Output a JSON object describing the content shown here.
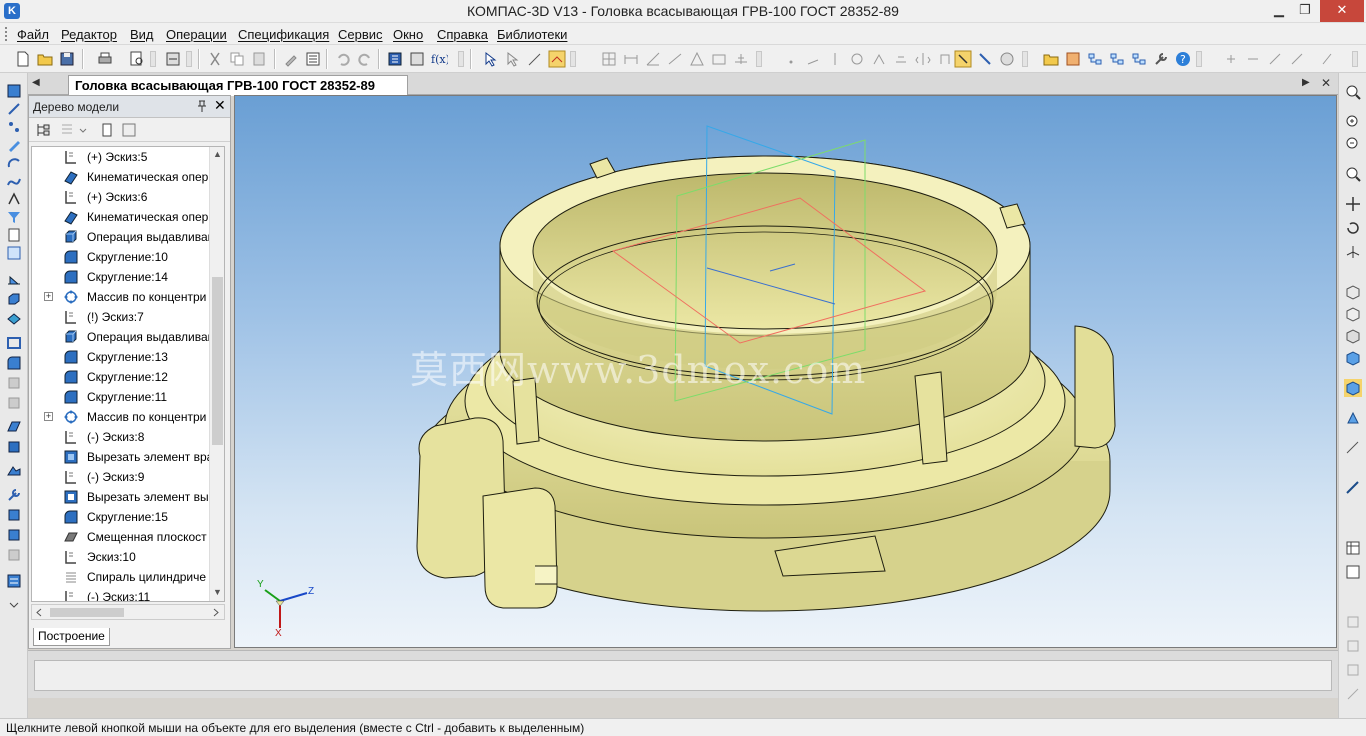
{
  "window": {
    "title": "КОМПАС-3D V13 - Головка всасывающая ГРВ-100 ГОСТ 28352-89",
    "minimize": "▁",
    "restore": "❐",
    "close": "✕"
  },
  "menu": [
    "Файл",
    "Редактор",
    "Вид",
    "Операции",
    "Спецификация",
    "Сервис",
    "Окно",
    "Справка",
    "Библиотеки"
  ],
  "document_tab": {
    "label": "Головка всасывающая ГРВ-100 ГОСТ 28352-89",
    "scroll_left": "◀",
    "scroll_right": "▶",
    "close": "✕"
  },
  "model_tree": {
    "title": "Дерево модели",
    "pin": "📌",
    "close": "✕",
    "items": [
      {
        "label": "(+) Эскиз:5",
        "icon": "sketch-icon",
        "expandable": false
      },
      {
        "label": "Кинематическая опер",
        "icon": "kinematic-icon",
        "expandable": false
      },
      {
        "label": "(+) Эскиз:6",
        "icon": "sketch-icon",
        "expandable": false
      },
      {
        "label": "Кинематическая опер",
        "icon": "kinematic-icon",
        "expandable": false
      },
      {
        "label": "Операция выдавливан",
        "icon": "extrude-icon",
        "expandable": false
      },
      {
        "label": "Скругление:10",
        "icon": "fillet-icon",
        "expandable": false
      },
      {
        "label": "Скругление:14",
        "icon": "fillet-icon",
        "expandable": false
      },
      {
        "label": "Массив по концентри",
        "icon": "array-icon",
        "expandable": true
      },
      {
        "label": "(!) Эскиз:7",
        "icon": "sketch-icon",
        "expandable": false
      },
      {
        "label": "Операция выдавливан",
        "icon": "extrude-icon",
        "expandable": false
      },
      {
        "label": "Скругление:13",
        "icon": "fillet-icon",
        "expandable": false
      },
      {
        "label": "Скругление:12",
        "icon": "fillet-icon",
        "expandable": false
      },
      {
        "label": "Скругление:11",
        "icon": "fillet-icon",
        "expandable": false
      },
      {
        "label": "Массив по концентри",
        "icon": "array-icon",
        "expandable": true
      },
      {
        "label": "(-) Эскиз:8",
        "icon": "sketch-icon",
        "expandable": false
      },
      {
        "label": "Вырезать элемент вра",
        "icon": "cut-rotate-icon",
        "expandable": false
      },
      {
        "label": "(-) Эскиз:9",
        "icon": "sketch-icon",
        "expandable": false
      },
      {
        "label": "Вырезать элемент вы",
        "icon": "cut-extrude-icon",
        "expandable": false
      },
      {
        "label": "Скругление:15",
        "icon": "fillet-icon",
        "expandable": false
      },
      {
        "label": "Смещенная плоскост",
        "icon": "plane-icon",
        "expandable": false
      },
      {
        "label": "Эскиз:10",
        "icon": "sketch-icon",
        "expandable": false
      },
      {
        "label": "Спираль цилиндриче",
        "icon": "spiral-icon",
        "expandable": false
      },
      {
        "label": "(-) Эскиз:11",
        "icon": "sketch-icon",
        "expandable": false
      }
    ],
    "bottom_tab": "Построение",
    "expander_symbol": "+",
    "scroll_up": "▲",
    "scroll_down": "▼"
  },
  "viewport": {
    "watermark": "莫西网www.3dmox.com",
    "axes": {
      "x": "X",
      "y": "Y",
      "z": "Z"
    },
    "colors": {
      "part": "#e8e49a",
      "edge": "#1e1e10",
      "axis_x": "#c01818",
      "axis_y": "#18a018",
      "axis_z": "#1848c8"
    }
  },
  "statusbar": {
    "message": "Щелкните левой кнопкой мыши на объекте для его выделения (вместе с Ctrl - добавить к выделенным)"
  }
}
